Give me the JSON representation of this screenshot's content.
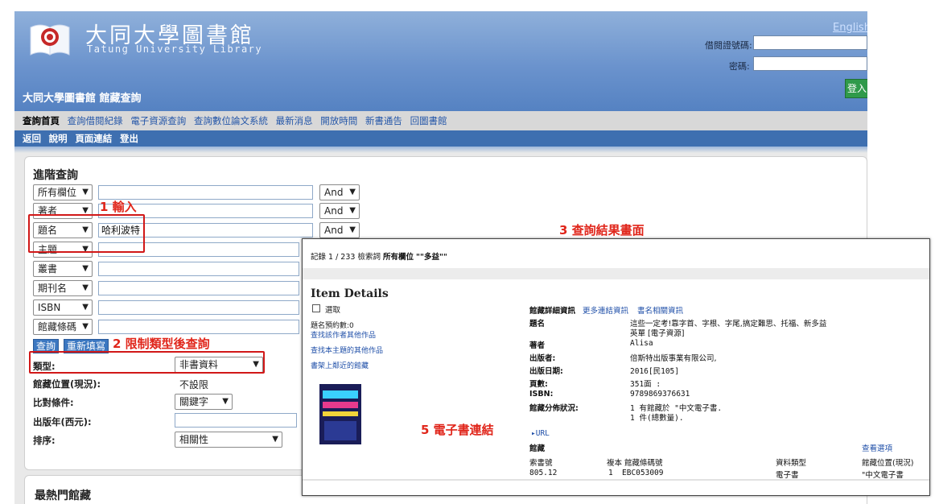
{
  "header": {
    "title_cn": "大同大學圖書館",
    "title_en": "Tatung University Library",
    "english_link": "English",
    "card_label": "借閱證號碼:",
    "password_label": "密碼:",
    "login_button": "登入",
    "page_title": "大同大學圖書館 館藏查詢"
  },
  "nav_primary": [
    "查詢首頁",
    "查詢借閱紀錄",
    "電子資源查詢",
    "查詢數位論文系統",
    "最新消息",
    "開放時間",
    "新書通告",
    "回圖書館"
  ],
  "nav_secondary": [
    "返回",
    "說明",
    "頁面連結",
    "登出"
  ],
  "search": {
    "title": "進階查詢",
    "rows": [
      {
        "field": "所有欄位",
        "value": "",
        "op": "And"
      },
      {
        "field": "著者",
        "value": "",
        "op": "And"
      },
      {
        "field": "題名",
        "value": "哈利波特",
        "op": "And"
      },
      {
        "field": "主題",
        "value": ""
      },
      {
        "field": "叢書",
        "value": ""
      },
      {
        "field": "期刊名",
        "value": ""
      },
      {
        "field": "ISBN",
        "value": ""
      },
      {
        "field": "館藏條碼",
        "value": ""
      }
    ],
    "query_button": "查詢",
    "reset_button": "重新填寫",
    "filters": {
      "type_label": "類型:",
      "type_value": "非書資料",
      "location_label": "館藏位置(現況):",
      "location_value": "不設限",
      "match_label": "比對條件:",
      "match_value": "關鍵字",
      "year_label": "出版年(西元):",
      "year_value": "",
      "sort_label": "排序:",
      "sort_value": "相關性"
    },
    "next_panel_title": "最熱門館藏"
  },
  "annotations": {
    "step1": "1 輸入",
    "step2": "2 限制類型後查詢",
    "step3": "3 查詢結果畫面",
    "step5": "5 電子書連結"
  },
  "result": {
    "record_prefix": "記錄 1 / 233 檢索詞",
    "record_field": "所有欄位",
    "record_term": "\"\"多益\"\"",
    "item_title": "Item Details",
    "select_label": "選取",
    "holds": "題名預約數:0",
    "left_links": [
      "查找該作者其他作品",
      "查找本主題的其他作品",
      "書架上鄰近的館藏"
    ],
    "top_links": [
      "館藏詳細資訊",
      "更多連結資訊",
      "書名相關資訊"
    ],
    "details": [
      {
        "label": "題名",
        "value": "這些一定考!靠字首、字根、字尾,搞定難思、托福、新多益"
      },
      {
        "label": "",
        "value": "英單 [電子資源]"
      },
      {
        "label": "著者",
        "value": "Alisa"
      },
      {
        "label": "出版者:",
        "value": "倍斯特出版事業有限公司,"
      },
      {
        "label": "出版日期:",
        "value": "2016[民105]"
      },
      {
        "label": "頁數:",
        "value": "351面 :"
      },
      {
        "label": "ISBN:",
        "value": "9789869376631"
      },
      {
        "label": "館藏分佈狀況:",
        "value": "1 有館藏於 \"中文電子書."
      },
      {
        "label": "",
        "value": "1 件(總數量)."
      }
    ],
    "url_link": "▸URL",
    "holdings_title": "館藏",
    "view_options": "查看選項",
    "columns": [
      "索書號",
      "複本 館藏條碼號",
      "資料類型",
      "館藏位置(現況)"
    ],
    "row": {
      "call_no": "805.12",
      "copy": "1",
      "barcode": "EBC053009",
      "type": "電子書",
      "location": "\"中文電子書"
    }
  }
}
